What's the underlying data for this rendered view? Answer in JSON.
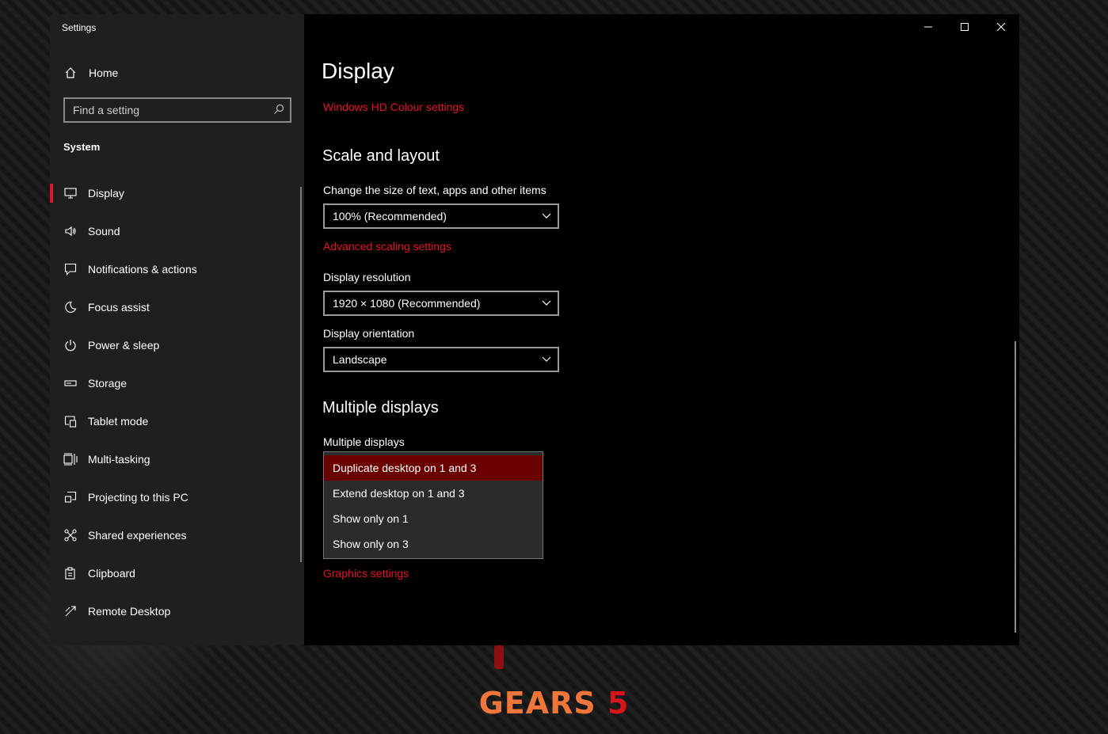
{
  "window": {
    "title": "Settings"
  },
  "sidebar": {
    "home_label": "Home",
    "search_placeholder": "Find a setting",
    "section": "System",
    "items": [
      {
        "label": "Display",
        "icon": "monitor-icon",
        "active": true
      },
      {
        "label": "Sound",
        "icon": "speaker-icon"
      },
      {
        "label": "Notifications & actions",
        "icon": "notification-icon"
      },
      {
        "label": "Focus assist",
        "icon": "moon-icon"
      },
      {
        "label": "Power & sleep",
        "icon": "power-icon"
      },
      {
        "label": "Storage",
        "icon": "storage-icon"
      },
      {
        "label": "Tablet mode",
        "icon": "tablet-mode-icon"
      },
      {
        "label": "Multi-tasking",
        "icon": "multitasking-icon"
      },
      {
        "label": "Projecting to this PC",
        "icon": "projecting-icon"
      },
      {
        "label": "Shared experiences",
        "icon": "shared-experiences-icon"
      },
      {
        "label": "Clipboard",
        "icon": "clipboard-icon"
      },
      {
        "label": "Remote Desktop",
        "icon": "remote-desktop-icon"
      }
    ]
  },
  "main": {
    "title": "Display",
    "hdr_link": "Windows HD Colour settings",
    "scale_layout": {
      "heading": "Scale and layout",
      "size_label": "Change the size of text, apps and other items",
      "size_value": "100% (Recommended)",
      "advanced_link": "Advanced scaling settings",
      "resolution_label": "Display resolution",
      "resolution_value": "1920 × 1080 (Recommended)",
      "orientation_label": "Display orientation",
      "orientation_value": "Landscape"
    },
    "multiple_displays": {
      "heading": "Multiple displays",
      "label": "Multiple displays",
      "options": [
        "Duplicate desktop on 1 and 3",
        "Extend desktop on 1 and 3",
        "Show only on 1",
        "Show only on 3"
      ],
      "selected_index": 0
    },
    "graphics_link": "Graphics settings"
  },
  "wallpaper": {
    "brand_word": "GEARS",
    "brand_num": "5"
  },
  "colors": {
    "accent": "#e81123",
    "selected_option": "#6b0000",
    "window_bg": "#000000",
    "sidebar_bg": "#1f1f1f"
  }
}
